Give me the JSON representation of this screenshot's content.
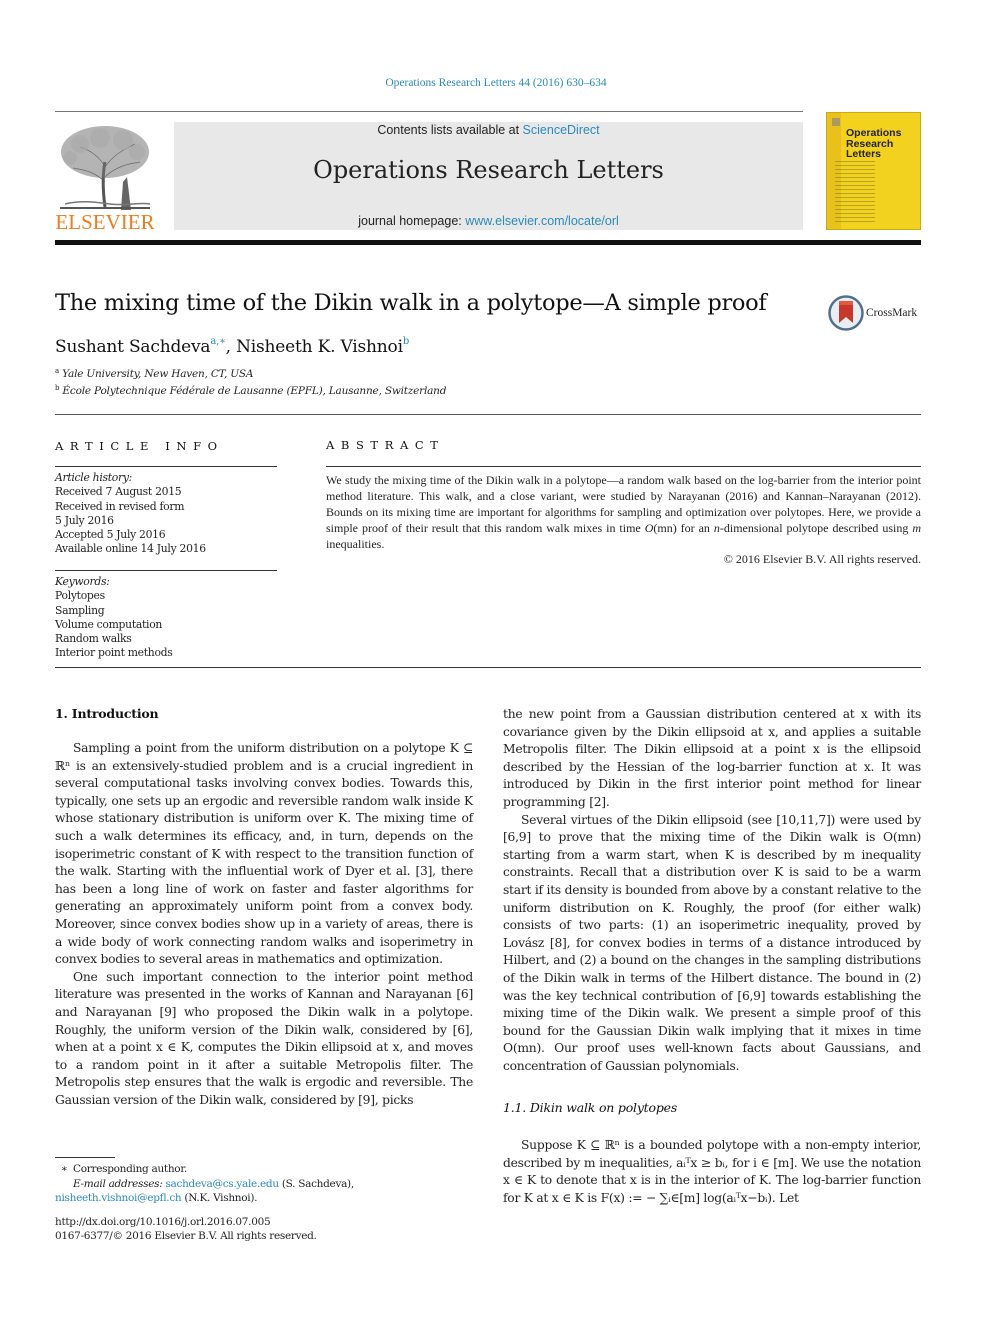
{
  "header": {
    "journal_ref": "Operations Research Letters 44 (2016) 630–634",
    "publisher_logo_text": "ELSEVIER",
    "contents_prefix": "Contents lists available at ",
    "contents_link": "ScienceDirect",
    "journal_title": "Operations Research Letters",
    "homepage_prefix": "journal homepage: ",
    "homepage_link": "www.elsevier.com/locate/orl",
    "cover_title_lines": [
      "Operations",
      "Research",
      "Letters"
    ],
    "brand_colors": {
      "elsevier_orange": "#f07b1b",
      "link_blue": "#2a8ab8",
      "cover_yellow": "#f2d21f"
    }
  },
  "article": {
    "title": "The mixing time of the Dikin walk in a polytope—A simple proof",
    "crossmark_label": "CrossMark",
    "authors": [
      {
        "name": "Sushant Sachdeva",
        "marks": "a,∗"
      },
      {
        "name": "Nisheeth K. Vishnoi",
        "marks": "b"
      }
    ],
    "author_separator": ", ",
    "affiliations": [
      {
        "mark": "a",
        "text": "Yale University, New Haven, CT, USA"
      },
      {
        "mark": "b",
        "text": "École Polytechnique Fédérale de Lausanne (EPFL), Lausanne, Switzerland"
      }
    ]
  },
  "article_info": {
    "heading": "ARTICLE INFO",
    "history_label": "Article history:",
    "history": [
      "Received 7 August 2015",
      "Received in revised form",
      "5 July 2016",
      "Accepted 5 July 2016",
      "Available online 14 July 2016"
    ],
    "keywords_label": "Keywords:",
    "keywords": [
      "Polytopes",
      "Sampling",
      "Volume computation",
      "Random walks",
      "Interior point methods"
    ]
  },
  "abstract": {
    "heading": "ABSTRACT",
    "text_1": "We study the mixing time of the Dikin walk in a polytope—a random walk based on the log-barrier from the interior point method literature. This walk, and a close variant, were studied by Narayanan (2016) and Kannan–Narayanan (2012). Bounds on its mixing time are important for algorithms for sampling and optimization over polytopes. Here, we provide a simple proof of their result that this random walk mixes in time ",
    "math_O": "O",
    "math_mn": "(mn)",
    "text_2": " for an ",
    "math_n": "n",
    "text_3": "-dimensional polytope described using ",
    "math_m": "m",
    "text_4": " inequalities.",
    "copyright": "© 2016 Elsevier B.V. All rights reserved."
  },
  "body": {
    "section1_heading": "1.  Introduction",
    "left_paragraphs": [
      "Sampling a point from the uniform distribution on a polytope K ⊆ ℝⁿ is an extensively-studied problem and is a crucial ingredient in several computational tasks involving convex bodies. Towards this, typically, one sets up an ergodic and reversible random walk inside K whose stationary distribution is uniform over K. The mixing time of such a walk determines its efficacy, and, in turn, depends on the isoperimetric constant of K with respect to the transition function of the walk. Starting with the influential work of Dyer et al. [3], there has been a long line of work on faster and faster algorithms for generating an approximately uniform point from a convex body. Moreover, since convex bodies show up in a variety of areas, there is a wide body of work connecting random walks and isoperimetry in convex bodies to several areas in mathematics and optimization.",
      "One such important connection to the interior point method literature was presented in the works of Kannan and Narayanan [6] and Narayanan [9] who proposed the Dikin walk in a polytope. Roughly, the uniform version of the Dikin walk, considered by [6], when at a point x ∈ K, computes the Dikin ellipsoid at x, and moves to a random point in it after a suitable Metropolis filter. The Metropolis step ensures that the walk is ergodic and reversible. The Gaussian version of the Dikin walk, considered by [9], picks"
    ],
    "right_continuation": "the new point from a Gaussian distribution centered at x with its covariance given by the Dikin ellipsoid at x, and applies a suitable Metropolis filter. The Dikin ellipsoid at a point x is the ellipsoid described by the Hessian of the log-barrier function at x. It was introduced by Dikin in the first interior point method for linear programming [2].",
    "right_paragraph_2": "Several virtues of the Dikin ellipsoid (see [10,11,7]) were used by [6,9] to prove that the mixing time of the Dikin walk is O(mn) starting from a warm start, when K is described by m inequality constraints. Recall that a distribution over K is said to be a warm start if its density is bounded from above by a constant relative to the uniform distribution on K. Roughly, the proof (for either walk) consists of two parts: (1) an isoperimetric inequality, proved by Lovász [8], for convex bodies in terms of a distance introduced by Hilbert, and (2) a bound on the changes in the sampling distributions of the Dikin walk in terms of the Hilbert distance. The bound in (2) was the key technical contribution of [6,9] towards establishing the mixing time of the Dikin walk. We present a simple proof of this bound for the Gaussian Dikin walk implying that it mixes in time O(mn). Our proof uses well-known facts about Gaussians, and concentration of Gaussian polynomials.",
    "section11_heading": "1.1.  Dikin walk on polytopes",
    "section11_text": "Suppose K ⊆ ℝⁿ is a bounded polytope with a non-empty interior, described by m inequalities, aᵢᵀx ≥ bᵢ, for i ∈ [m]. We use the notation x ∈ K to denote that x is in the interior of K. The log-barrier function for K at x ∈ K is F(x) := − ∑ᵢ∈[m] log(aᵢᵀx−bᵢ). Let"
  },
  "footnotes": {
    "corresponding_mark": "∗",
    "corresponding_text": "Corresponding author.",
    "email_label": "E-mail addresses: ",
    "email_1": "sachdeva@cs.yale.edu",
    "email_1_owner": " (S. Sachdeva),",
    "email_2": "nisheeth.vishnoi@epfl.ch",
    "email_2_owner": " (N.K. Vishnoi).",
    "doi": "http://dx.doi.org/10.1016/j.orl.2016.07.005",
    "issn_copyright": "0167-6377/© 2016 Elsevier B.V. All rights reserved."
  }
}
